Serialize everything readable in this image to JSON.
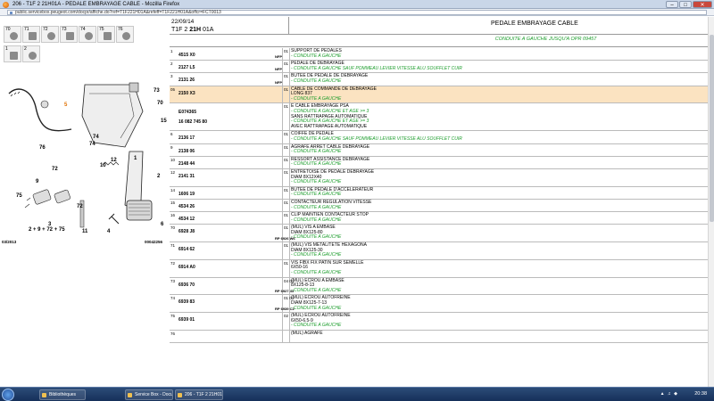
{
  "window": {
    "title": "206 - T1F 2 21H01A - PEDALE EMBRAYAGE CABLE - Mozilla Firefox"
  },
  "browser": {
    "url": "public.servicebox.peugeot.com/docpr/affiche.do?ref=T1F221H01A&refeff=T1F221H01A&offcr=FCT0013"
  },
  "header": {
    "date": "22/09/14",
    "ref_prefix": "T1F 2 ",
    "ref_bold": "21H",
    "ref_suffix": " 01A",
    "title": "PEDALE EMBRAYAGE CABLE"
  },
  "subheader": "CONDUITE A GAUCHE JUSQU'A OPR 09457",
  "part_icons": [
    {
      "label": "70"
    },
    {
      "label": "71"
    },
    {
      "label": "72"
    },
    {
      "label": "73"
    },
    {
      "label": "74"
    },
    {
      "label": "75"
    },
    {
      "label": "76"
    },
    {
      "label": "1"
    },
    {
      "label": "2"
    }
  ],
  "diagram": {
    "labels": [
      "5",
      "73",
      "70",
      "74",
      "15",
      "76",
      "74",
      "9",
      "72",
      "75",
      "10",
      "12",
      "11",
      "6",
      "4",
      "2",
      "72",
      "1"
    ],
    "formula": "2 + 9 + 72 + 75",
    "formula_num": "3",
    "left_code": "03/2013",
    "right_code": "00042256"
  },
  "rows": [
    {
      "n": "1",
      "num": "4515 X0",
      "nfp": "NFP",
      "qty": "01",
      "lines": [
        {
          "t": "SUPPORT DE PEDALES",
          "g": false
        },
        {
          "t": "- CONDUITE A GAUCHE",
          "g": true
        }
      ]
    },
    {
      "n": "2",
      "num": "2127 L5",
      "nfp": "NFP",
      "qty": "01",
      "lines": [
        {
          "t": "PEDALE DE DEBRAYAGE",
          "g": false
        },
        {
          "t": "- CONDUITE A GAUCHE SAUF POMMEAU LEVIER VITESSE ALU SOUFFLET CUIR",
          "g": true
        }
      ]
    },
    {
      "n": "3",
      "num": "2131 26",
      "nfp": "NFP",
      "qty": "01",
      "lines": [
        {
          "t": "BUTEE DE PEDALE DE DEBRAYAGE",
          "g": false
        },
        {
          "t": "- CONDUITE A GAUCHE",
          "g": true
        }
      ]
    },
    {
      "n": "05",
      "num": "2150 X3",
      "nfp": "",
      "qty": "01",
      "hl": true,
      "lines": [
        {
          "t": "CABLE DE COMMANDE DE DEBRAYAGE",
          "g": false
        },
        {
          "t": "LONG 837",
          "g": false
        },
        {
          "t": "- CONDUITE A GAUCHE",
          "g": true
        }
      ]
    },
    {
      "n": "",
      "num": "E074365",
      "num2": "16 082 745 80",
      "nfp": "",
      "qty": "01",
      "lines": [
        {
          "t": "E CABLE EMBRAYAGE PSA",
          "g": false
        },
        {
          "t": "- CONDUITE A GAUCHE ET AGE >= 3",
          "g": true
        },
        {
          "t": "SANS RATTRAPAGE AUTOMATIQUE",
          "g": false
        },
        {
          "t": "- CONDUITE A GAUCHE ET AGE >= 3",
          "g": true
        },
        {
          "t": "AVEC RATTRAPAGE AUTOMATIQUE",
          "g": false
        }
      ]
    },
    {
      "n": "6",
      "num": "2136 17",
      "nfp": "",
      "qty": "01",
      "lines": [
        {
          "t": "COIFFE DE PEDALE",
          "g": false
        },
        {
          "t": "- CONDUITE A GAUCHE SAUF POMMEAU LEVIER VITESSE ALU SOUFFLET CUIR",
          "g": true
        }
      ]
    },
    {
      "n": "9",
      "num": "2138 06",
      "nfp": "",
      "qty": "01",
      "lines": [
        {
          "t": "AGRAFE ARRET CABLE DEBRAYAGE",
          "g": false
        },
        {
          "t": "- CONDUITE A GAUCHE",
          "g": true
        }
      ]
    },
    {
      "n": "10",
      "num": "2148 44",
      "nfp": "",
      "qty": "01",
      "lines": [
        {
          "t": "RESSORT ASSISTANCE DEBRAYAGE",
          "g": false
        },
        {
          "t": "- CONDUITE A GAUCHE",
          "g": true
        }
      ]
    },
    {
      "n": "12",
      "num": "2141 31",
      "nfp": "",
      "qty": "01",
      "lines": [
        {
          "t": "ENTRETOISE DE PEDALE DEBRAYAGE",
          "g": false
        },
        {
          "t": "DIAM 8X12X40",
          "g": false
        },
        {
          "t": "- CONDUITE A GAUCHE",
          "g": true
        }
      ]
    },
    {
      "n": "14",
      "num": "1606 19",
      "nfp": "",
      "qty": "01",
      "lines": [
        {
          "t": "BUTEE DE PEDALE D'ACCELERATEUR",
          "g": false
        },
        {
          "t": "- CONDUITE A GAUCHE",
          "g": true
        }
      ]
    },
    {
      "n": "15",
      "num": "4534 26",
      "nfp": "",
      "qty": "01",
      "lines": [
        {
          "t": "CONTACTEUR REGULATION VITESSE",
          "g": false
        },
        {
          "t": "- CONDUITE A GAUCHE",
          "g": true
        }
      ]
    },
    {
      "n": "16",
      "num": "4534 12",
      "nfp": "",
      "qty": "01",
      "lines": [
        {
          "t": "CLIP MAINTIEN CONTACTEUR STOP",
          "g": false
        },
        {
          "t": "- CONDUITE A GAUCHE",
          "g": true
        }
      ]
    },
    {
      "n": "70",
      "num": "6928 J8",
      "nfp": "RP 6926 W6",
      "qty": "01",
      "lines": [
        {
          "t": "(MUL) VIS A EMBASE",
          "g": false
        },
        {
          "t": "DIAM 8X125-80",
          "g": false
        },
        {
          "t": "- CONDUITE A GAUCHE",
          "g": true
        }
      ]
    },
    {
      "n": "71",
      "num": "6914 62",
      "nfp": "",
      "qty": "01",
      "lines": [
        {
          "t": "(MUL) VIS METAL/TETE HEXAGONA",
          "g": false
        },
        {
          "t": "DIAM 8X125-30",
          "g": false
        },
        {
          "t": "- CONDUITE A GAUCHE",
          "g": true
        }
      ]
    },
    {
      "n": "72",
      "num": "6914 A0",
      "nfp": "",
      "qty": "01",
      "lines": [
        {
          "t": "VIS FIBX FIX PATIN SUR SEMELLE",
          "g": false
        },
        {
          "t": "6X50-16",
          "g": false
        },
        {
          "t": "- CONDUITE A GAUCHE",
          "g": true
        }
      ]
    },
    {
      "n": "73",
      "num": "6936 70",
      "nfp": "RP 6927 43",
      "qty": "04 01",
      "lines": [
        {
          "t": "(MUL) ECROU A EMBASE",
          "g": false
        },
        {
          "t": "8X125-8-13",
          "g": false
        },
        {
          "t": "- CONDUITE A GAUCHE",
          "g": true
        }
      ]
    },
    {
      "n": "74",
      "num": "6939 83",
      "nfp": "RP 6939 C2",
      "qty": "01 01",
      "lines": [
        {
          "t": "(MUL) ECROU AUTOFREINE",
          "g": false
        },
        {
          "t": "DIAM 8X125-7-13",
          "g": false
        },
        {
          "t": "- CONDUITE A GAUCHE",
          "g": true
        }
      ]
    },
    {
      "n": "75",
      "num": "6939 01",
      "nfp": "",
      "qty": "02",
      "lines": [
        {
          "t": "(MUL) ECROU AUTOFREINE",
          "g": false
        },
        {
          "t": "6X50-6.5-9",
          "g": false
        },
        {
          "t": "- CONDUITE A GAUCHE",
          "g": true
        }
      ]
    },
    {
      "n": "76",
      "num": "",
      "nfp": "",
      "qty": "",
      "lines": [
        {
          "t": "(MUL) AGRAFE",
          "g": false
        }
      ]
    }
  ],
  "taskbar": {
    "items": [
      {
        "label": "Bibliothèques"
      },
      {
        "label": "Service Box - Docum..."
      },
      {
        "label": "206 - T1F 2 21H01A..."
      }
    ],
    "clock": "20:38"
  },
  "colors": {
    "highlight": "#fbe3c1",
    "green": "#1a9c2a"
  }
}
